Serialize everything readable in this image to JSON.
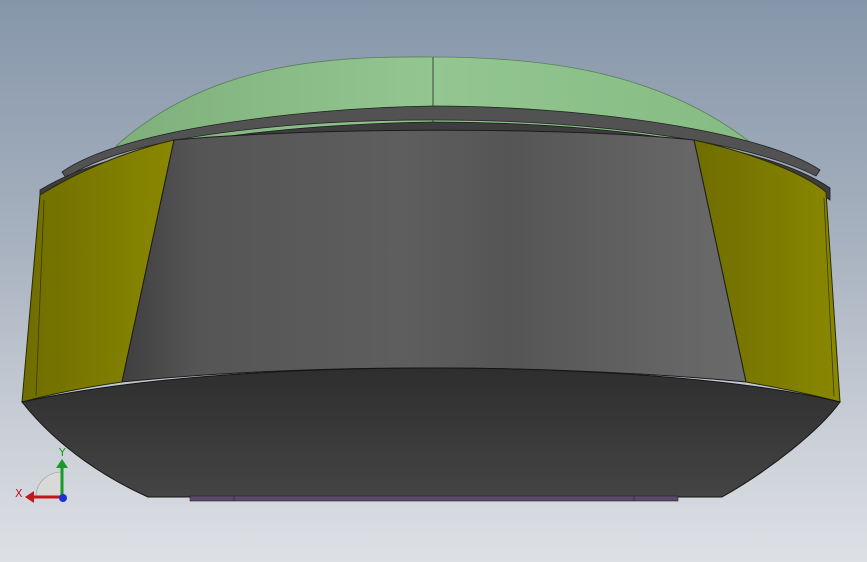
{
  "viewport": {
    "background_top": "#8696aa",
    "background_bottom": "#dde0e4"
  },
  "model": {
    "dome_color": "#8fc38d",
    "body_color": "#5b5b5b",
    "side_panel_color": "#858300",
    "base_color": "#3b3b3b",
    "rim_color": "#4a4a4a"
  },
  "triad": {
    "x_label": "X",
    "y_label": "Y",
    "x_color": "#c0161c",
    "y_color": "#1a9a2a",
    "z_color": "#1c2fd8"
  }
}
